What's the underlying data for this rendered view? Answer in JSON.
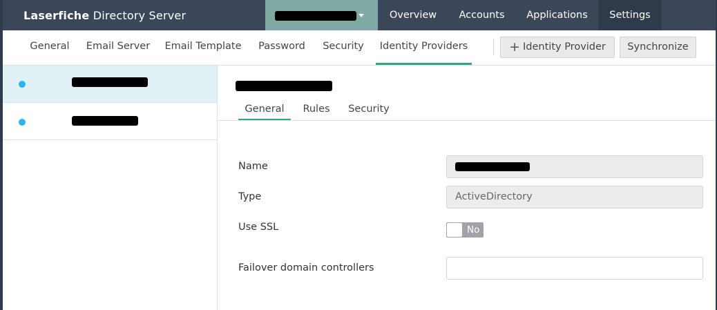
{
  "app": {
    "brand_bold": "Laserfiche",
    "brand_rest": " Directory Server"
  },
  "nav": {
    "overview": "Overview",
    "accounts": "Accounts",
    "applications": "Applications",
    "settings": "Settings"
  },
  "subtabs": {
    "general": "General",
    "email_server": "Email Server",
    "email_template": "Email Template",
    "password": "Password",
    "security": "Security",
    "identity_providers": "Identity Providers"
  },
  "actions": {
    "add_plus": "+",
    "add_identity_provider": "Identity Provider",
    "synchronize": "Synchronize"
  },
  "detail": {
    "tabs": {
      "general": "General",
      "rules": "Rules",
      "security": "Security"
    },
    "labels": {
      "name": "Name",
      "type": "Type",
      "use_ssl": "Use SSL",
      "failover": "Failover domain controllers"
    },
    "values": {
      "type": "ActiveDirectory",
      "use_ssl": "No",
      "failover": ""
    }
  },
  "colors": {
    "topbar": "#3c4659",
    "org_select": "#7fa9a3",
    "accent": "#2fa58c",
    "status_dot": "#2bb4f2",
    "selected_row": "#e1f1f5"
  }
}
